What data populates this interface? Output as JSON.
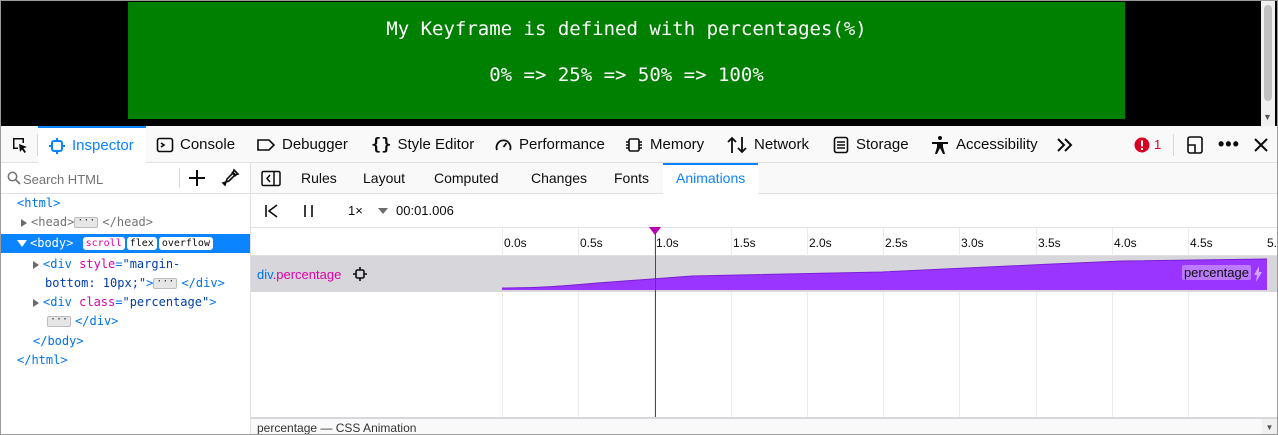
{
  "preview": {
    "title": "My Keyframe is defined with percentages(%)",
    "sequence": "0% => 25% => 50% => 100%",
    "box_color": "#008000"
  },
  "toolbox": {
    "picker_icon": "element-picker-icon",
    "tabs": [
      {
        "label": "Inspector",
        "icon": "inspector-icon",
        "active": true
      },
      {
        "label": "Console",
        "icon": "console-icon"
      },
      {
        "label": "Debugger",
        "icon": "debugger-icon"
      },
      {
        "label": "Style Editor",
        "icon": "braces-icon"
      },
      {
        "label": "Performance",
        "icon": "gauge-icon"
      },
      {
        "label": "Memory",
        "icon": "chip-icon"
      },
      {
        "label": "Network",
        "icon": "network-arrows-icon"
      },
      {
        "label": "Storage",
        "icon": "storage-icon"
      },
      {
        "label": "Accessibility",
        "icon": "accessibility-icon"
      }
    ],
    "overflow_icon": "chevrons-right-icon",
    "error_count": "1",
    "error_color": "#d70022"
  },
  "markup": {
    "search_placeholder": "Search HTML",
    "tree": {
      "html_open": "<html>",
      "head_open": "<head>",
      "head_close": "</head>",
      "body_open": "<body>",
      "badges": [
        "scroll",
        "flex",
        "overflow"
      ],
      "div1_tag": "<div ",
      "div1_attr": "style",
      "div1_val_1": "\"margin-",
      "div1_val_2": "bottom: 10px;\"",
      "div1_gt": ">",
      "div1_close": "</div>",
      "div2_tag": "<div ",
      "div2_attr": "class",
      "div2_val": "\"percentage\"",
      "div2_gt": ">",
      "div2_close": "</div>",
      "body_close": "</body>",
      "html_close": "</html>"
    }
  },
  "sidebar": {
    "tabs": [
      "Rules",
      "Layout",
      "Computed",
      "Changes",
      "Fonts",
      "Animations"
    ],
    "active_tab": "Animations",
    "animations": {
      "rate": "1×",
      "current_time": "00:01.006",
      "ticks": [
        "0.0s",
        "0.5s",
        "1.0s",
        "1.5s",
        "2.0s",
        "2.5s",
        "3.0s",
        "3.5s",
        "4.0s",
        "4.5s",
        "5."
      ],
      "target_tag": "div",
      "target_class": ".percentage",
      "animation_name": "percentage",
      "bar_color": "#9935ff",
      "scrubber_color": "#b500b5",
      "bottom_label": "percentage — CSS Animation"
    }
  }
}
